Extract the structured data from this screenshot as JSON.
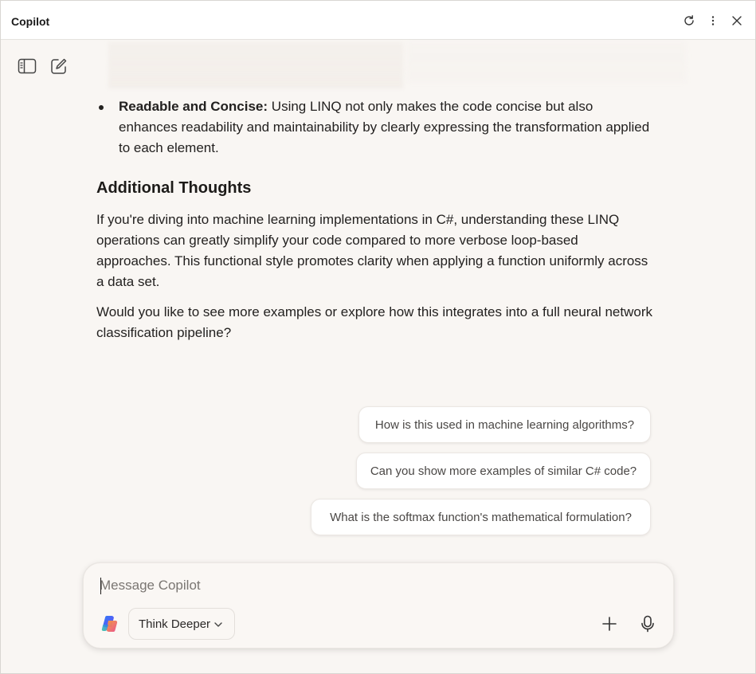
{
  "window": {
    "title": "Copilot"
  },
  "icons": {
    "refresh": "refresh-icon",
    "more": "more-vertical-icon",
    "close": "close-icon",
    "sidebar": "sidebar-toggle-icon",
    "new_chat": "new-chat-icon",
    "copilot": "copilot-logo-icon",
    "chevron": "chevron-down-icon",
    "add": "plus-icon",
    "mic": "microphone-icon"
  },
  "content": {
    "bullet": {
      "title": "Readable and Concise:",
      "text": " Using LINQ not only makes the code concise but also enhances readability and maintainability by clearly expressing the transformation applied to each element."
    },
    "heading": "Additional Thoughts",
    "paragraphs": [
      "If you're diving into machine learning implementations in C#, understanding these LINQ operations can greatly simplify your code compared to more verbose loop-based approaches. This functional style promotes clarity when applying a function uniformly across a data set.",
      "Would you like to see more examples or explore how this integrates into a full neural network classification pipeline?"
    ]
  },
  "suggestions": [
    "How is this used in machine learning algorithms?",
    "Can you show more examples of similar C# code?",
    "What is the softmax function's mathematical formulation?"
  ],
  "composer": {
    "placeholder": "Message Copilot",
    "mode_label": "Think Deeper"
  }
}
